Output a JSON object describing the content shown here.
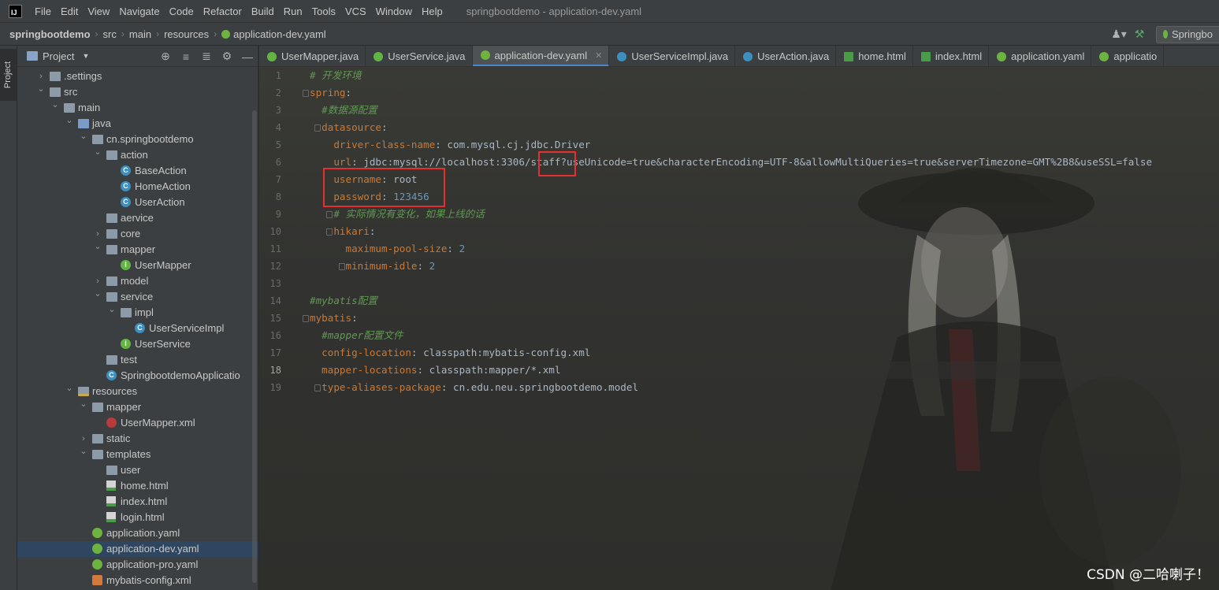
{
  "menubar": {
    "items": [
      "File",
      "Edit",
      "View",
      "Navigate",
      "Code",
      "Refactor",
      "Build",
      "Run",
      "Tools",
      "VCS",
      "Window",
      "Help"
    ],
    "window_title": "springbootdemo - application-dev.yaml"
  },
  "navbar": {
    "crumbs": [
      "springbootdemo",
      "src",
      "main",
      "resources",
      "application-dev.yaml"
    ],
    "run_config": "Springbo"
  },
  "left_stripe": {
    "project_tab": "Project"
  },
  "project_panel": {
    "title": "Project",
    "tree": [
      {
        "label": ".settings",
        "type": "folder",
        "depth": 1,
        "expand": "closed"
      },
      {
        "label": "src",
        "type": "folder",
        "depth": 1,
        "expand": "open"
      },
      {
        "label": "main",
        "type": "folder",
        "depth": 2,
        "expand": "open"
      },
      {
        "label": "java",
        "type": "folder-blue",
        "depth": 3,
        "expand": "open"
      },
      {
        "label": "cn.springbootdemo",
        "type": "folder",
        "depth": 4,
        "expand": "open"
      },
      {
        "label": "action",
        "type": "folder",
        "depth": 5,
        "expand": "open"
      },
      {
        "label": "BaseAction",
        "type": "class",
        "depth": 6,
        "expand": "none"
      },
      {
        "label": "HomeAction",
        "type": "class",
        "depth": 6,
        "expand": "none"
      },
      {
        "label": "UserAction",
        "type": "class",
        "depth": 6,
        "expand": "none"
      },
      {
        "label": "aervice",
        "type": "folder",
        "depth": 5,
        "expand": "none"
      },
      {
        "label": "core",
        "type": "folder",
        "depth": 5,
        "expand": "closed"
      },
      {
        "label": "mapper",
        "type": "folder",
        "depth": 5,
        "expand": "open"
      },
      {
        "label": "UserMapper",
        "type": "interface",
        "depth": 6,
        "expand": "none"
      },
      {
        "label": "model",
        "type": "folder",
        "depth": 5,
        "expand": "closed"
      },
      {
        "label": "service",
        "type": "folder",
        "depth": 5,
        "expand": "open"
      },
      {
        "label": "impl",
        "type": "folder",
        "depth": 6,
        "expand": "open"
      },
      {
        "label": "UserServiceImpl",
        "type": "class",
        "depth": 7,
        "expand": "none"
      },
      {
        "label": "UserService",
        "type": "interface",
        "depth": 6,
        "expand": "none"
      },
      {
        "label": "test",
        "type": "folder",
        "depth": 5,
        "expand": "none"
      },
      {
        "label": "SpringbootdemoApplicatio",
        "type": "spring-class",
        "depth": 5,
        "expand": "none"
      },
      {
        "label": "resources",
        "type": "folder-res",
        "depth": 3,
        "expand": "open"
      },
      {
        "label": "mapper",
        "type": "folder",
        "depth": 4,
        "expand": "open"
      },
      {
        "label": "UserMapper.xml",
        "type": "mybatis",
        "depth": 5,
        "expand": "none"
      },
      {
        "label": "static",
        "type": "folder",
        "depth": 4,
        "expand": "closed"
      },
      {
        "label": "templates",
        "type": "folder",
        "depth": 4,
        "expand": "open"
      },
      {
        "label": "user",
        "type": "folder",
        "depth": 5,
        "expand": "none"
      },
      {
        "label": "home.html",
        "type": "html",
        "depth": 5,
        "expand": "none"
      },
      {
        "label": "index.html",
        "type": "html",
        "depth": 5,
        "expand": "none"
      },
      {
        "label": "login.html",
        "type": "html",
        "depth": 5,
        "expand": "none"
      },
      {
        "label": "application.yaml",
        "type": "spring",
        "depth": 4,
        "expand": "none"
      },
      {
        "label": "application-dev.yaml",
        "type": "spring",
        "depth": 4,
        "expand": "none",
        "selected": true
      },
      {
        "label": "application-pro.yaml",
        "type": "spring",
        "depth": 4,
        "expand": "none"
      },
      {
        "label": "mybatis-config.xml",
        "type": "xml",
        "depth": 4,
        "expand": "none"
      }
    ]
  },
  "editor": {
    "tabs": [
      {
        "label": "UserMapper.java",
        "icon": "interface",
        "active": false
      },
      {
        "label": "UserService.java",
        "icon": "interface",
        "active": false
      },
      {
        "label": "application-dev.yaml",
        "icon": "spring",
        "active": true
      },
      {
        "label": "UserServiceImpl.java",
        "icon": "class",
        "active": false
      },
      {
        "label": "UserAction.java",
        "icon": "class",
        "active": false
      },
      {
        "label": "home.html",
        "icon": "html",
        "active": false
      },
      {
        "label": "index.html",
        "icon": "html",
        "active": false
      },
      {
        "label": "application.yaml",
        "icon": "spring",
        "active": false
      },
      {
        "label": "applicatio",
        "icon": "spring",
        "active": false
      }
    ],
    "current_line": 18,
    "lines": [
      [
        {
          "t": "# 开发环境",
          "c": "c"
        }
      ],
      [
        {
          "t": "spring",
          "c": "k"
        },
        {
          "t": ":",
          "c": "v"
        }
      ],
      [
        {
          "t": "  #数据源配置",
          "c": "c"
        }
      ],
      [
        {
          "t": "  ",
          "c": "v"
        },
        {
          "t": "datasource",
          "c": "k"
        },
        {
          "t": ":",
          "c": "v"
        }
      ],
      [
        {
          "t": "    ",
          "c": "v"
        },
        {
          "t": "driver-class-name",
          "c": "k"
        },
        {
          "t": ": com.mysql.cj.jdbc.Driver",
          "c": "v"
        }
      ],
      [
        {
          "t": "    ",
          "c": "v"
        },
        {
          "t": "url",
          "c": "k"
        },
        {
          "t": ": jdbc:mysql://localhost:3306/staff?useUnicode=true&characterEncoding=UTF-8&allowMultiQueries=true&serverTimezone=GMT%2B8&useSSL=false",
          "c": "v"
        }
      ],
      [
        {
          "t": "    ",
          "c": "v"
        },
        {
          "t": "username",
          "c": "k"
        },
        {
          "t": ": root",
          "c": "v"
        }
      ],
      [
        {
          "t": "    ",
          "c": "v"
        },
        {
          "t": "password",
          "c": "k"
        },
        {
          "t": ": ",
          "c": "v"
        },
        {
          "t": "123456",
          "c": "n"
        }
      ],
      [
        {
          "t": "    # 实际情况有变化，如果上线的话",
          "c": "c"
        }
      ],
      [
        {
          "t": "    ",
          "c": "v"
        },
        {
          "t": "hikari",
          "c": "k"
        },
        {
          "t": ":",
          "c": "v"
        }
      ],
      [
        {
          "t": "      ",
          "c": "v"
        },
        {
          "t": "maximum-pool-size",
          "c": "k"
        },
        {
          "t": ": ",
          "c": "v"
        },
        {
          "t": "2",
          "c": "n"
        }
      ],
      [
        {
          "t": "      ",
          "c": "v"
        },
        {
          "t": "minimum-idle",
          "c": "k"
        },
        {
          "t": ": ",
          "c": "v"
        },
        {
          "t": "2",
          "c": "n"
        }
      ],
      [],
      [
        {
          "t": "#mybatis配置",
          "c": "c"
        }
      ],
      [
        {
          "t": "mybatis",
          "c": "k"
        },
        {
          "t": ":",
          "c": "v"
        }
      ],
      [
        {
          "t": "  #mapper配置文件",
          "c": "c"
        }
      ],
      [
        {
          "t": "  ",
          "c": "v"
        },
        {
          "t": "config-location",
          "c": "k"
        },
        {
          "t": ": classpath:mybatis-config.xml",
          "c": "v"
        }
      ],
      [
        {
          "t": "  ",
          "c": "v"
        },
        {
          "t": "mapper-locations",
          "c": "k"
        },
        {
          "t": ": classpath:mapper/*.xml",
          "c": "v"
        }
      ],
      [
        {
          "t": "  ",
          "c": "v"
        },
        {
          "t": "type-aliases-package",
          "c": "k"
        },
        {
          "t": ": cn.edu.neu.springbootdemo.model",
          "c": "v"
        }
      ]
    ]
  },
  "watermark": "CSDN @二哈喇子！",
  "colors": {
    "key": "#cc7832",
    "value": "#a9b7c6",
    "number": "#6897bb",
    "comment": "#629755",
    "annotation_box": "#e53030"
  }
}
